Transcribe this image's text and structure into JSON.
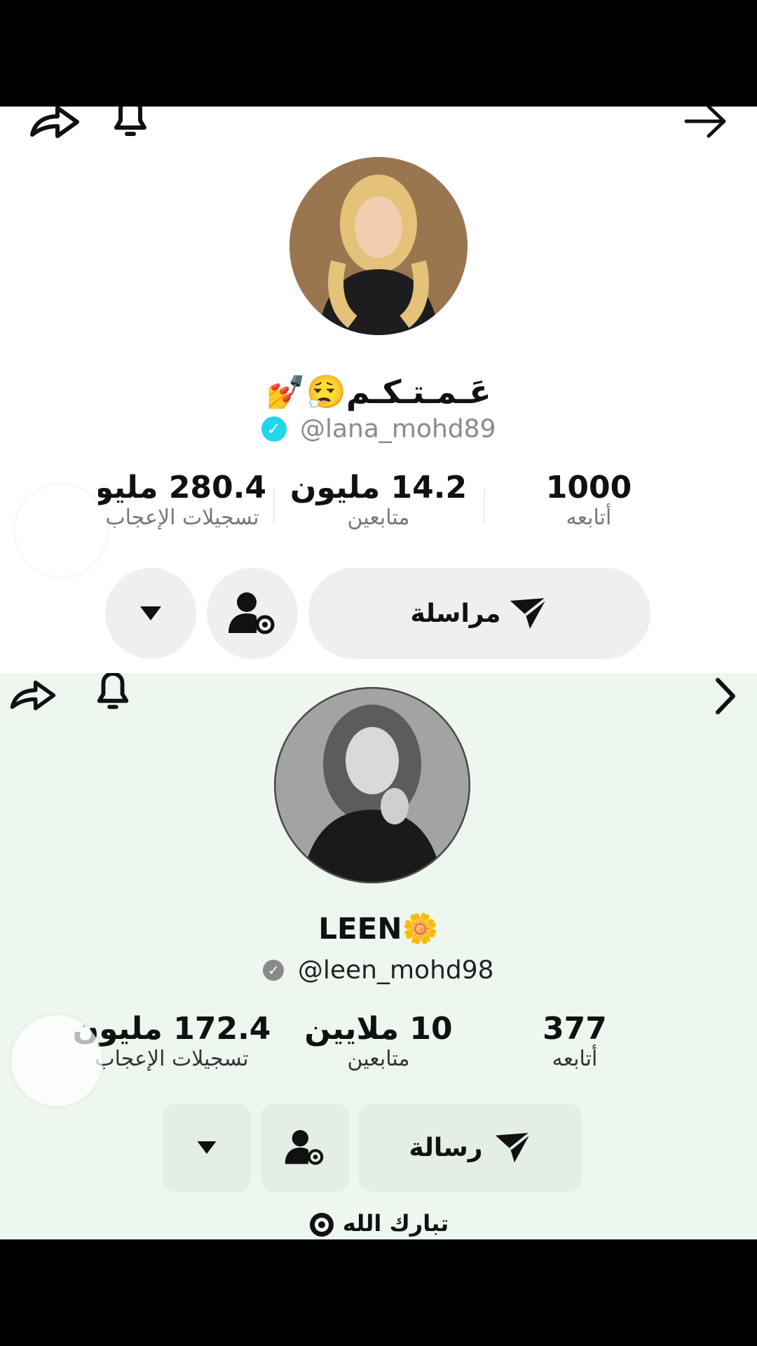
{
  "profiles": [
    {
      "display_name": "عَـمـتـكـم😮‍💨💅",
      "handle": "@lana_mohd89",
      "verified_color": "#20d5ec",
      "stats": {
        "likes_value": "280.4 مليون",
        "likes_label": "تسجيلات الإعجاب",
        "followers_value": "14.2 مليون",
        "followers_label": "متابعين",
        "following_value": "1000",
        "following_label": "أتابعه"
      },
      "message_button_label": "مراسلة",
      "icons": [
        "share-icon",
        "bell-icon",
        "arrow-right-icon",
        "send-icon",
        "user-settings-icon",
        "dropdown-icon"
      ]
    },
    {
      "display_name": "LEEN🌼",
      "handle": "@leen_mohd98",
      "verified_color": "#8a8a8a",
      "stats": {
        "likes_value": "172.4 مليون",
        "likes_label": "تسجيلات الإعجاب",
        "followers_value": "10 ملايين",
        "followers_label": "متابعين",
        "following_value": "377",
        "following_label": "أتابعه"
      },
      "message_button_label": "رسالة",
      "bottom_tag": "تبارك الله",
      "icons": [
        "share-icon",
        "bell-icon",
        "chevron-right-icon",
        "send-icon",
        "user-settings-icon",
        "dropdown-icon"
      ]
    }
  ],
  "colors": {
    "panel1_bg": "#ffffff",
    "panel2_bg": "#eef7ef",
    "button_bg": "#efefef"
  }
}
